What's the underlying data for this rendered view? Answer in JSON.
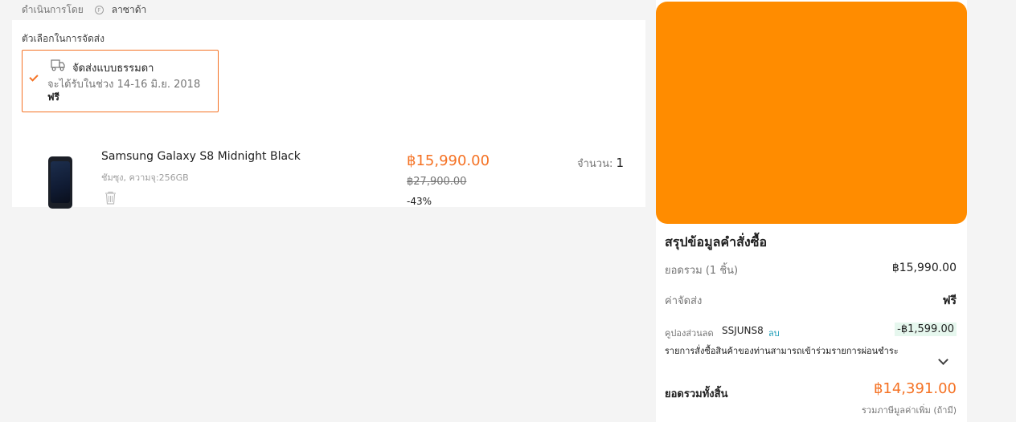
{
  "fulfilled": {
    "label": "ดำเนินการโดย",
    "seller_badge": "F",
    "seller": "ลาซาด้า"
  },
  "delivery": {
    "title": "ตัวเลือกในการจัดส่ง",
    "option": {
      "name": "จัดส่งแบบธรรมดา",
      "date": "จะได้รับในช่วง 14-16 มิ.ย. 2018",
      "price": "ฟรี"
    }
  },
  "product": {
    "name": "Samsung Galaxy S8 Midnight Black",
    "variant": "ชัมซุง, ความจุ:256GB",
    "price": "฿15,990.00",
    "original_price": "฿27,900.00",
    "discount": "-43%",
    "qty_label": "จำนวน:",
    "qty": "1"
  },
  "summary": {
    "banner_color": "#ff8c00",
    "title": "สรุปข้อมูลคำสั่งซื้อ",
    "subtotal_label": "ยอดรวม (1 ชิ้น)",
    "subtotal": "฿15,990.00",
    "shipping_label": "ค่าจัดส่ง",
    "shipping": "ฟรี",
    "coupon_label": "คูปองส่วนลด",
    "coupon_code": "SSJUNS8",
    "coupon_remove": "ลบ",
    "coupon_value": "-฿1,599.00",
    "installment_note": "รายการสั่งซื้อสินค้าของท่านสามารถเข้าร่วมรายการผ่อนชำระ",
    "total_label": "ยอดรวมทั้งสิ้น",
    "total": "฿14,391.00",
    "vat_note": "รวมภาษีมูลค่าเพิ่ม (ถ้ามี)"
  },
  "colors": {
    "accent": "#f57224",
    "link": "#1a9cb7"
  },
  "icons": [
    "truck-icon",
    "check-icon",
    "trash-icon",
    "chevron-down-icon",
    "seller-icon"
  ]
}
